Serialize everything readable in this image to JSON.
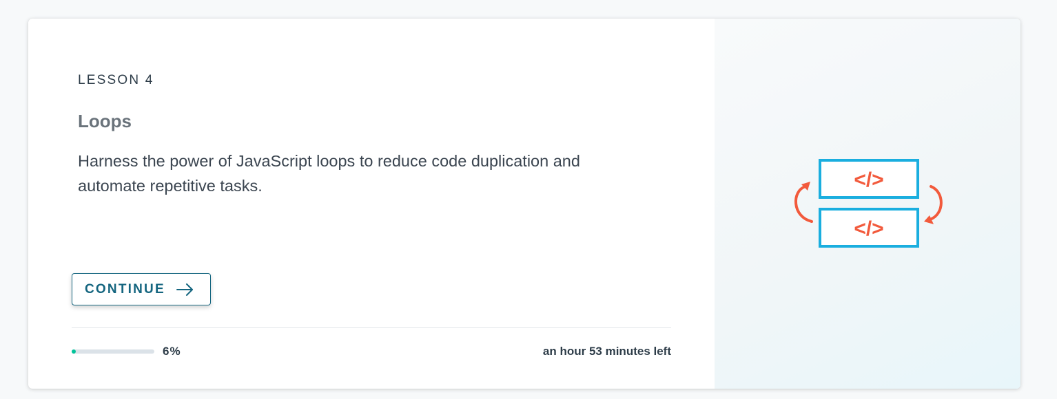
{
  "lesson": {
    "label": "LESSON 4",
    "title": "Loops",
    "description": "Harness the power of JavaScript loops to reduce code duplication and automate repetitive tasks."
  },
  "actions": {
    "continue_label": "CONTINUE",
    "continue_icon": "arrow-right-icon"
  },
  "progress": {
    "percent": 6,
    "percent_text": "6%",
    "time_left": "an hour 53 minutes left"
  },
  "illustration": {
    "icon": "code-loop-illustration",
    "code_tag_top": "</>",
    "code_tag_bottom": "</>"
  },
  "colors": {
    "accent": "#14657f",
    "progress_dot": "#02c39a",
    "illustration_blue": "#1aaedf",
    "illustration_red": "#f25a3c"
  }
}
